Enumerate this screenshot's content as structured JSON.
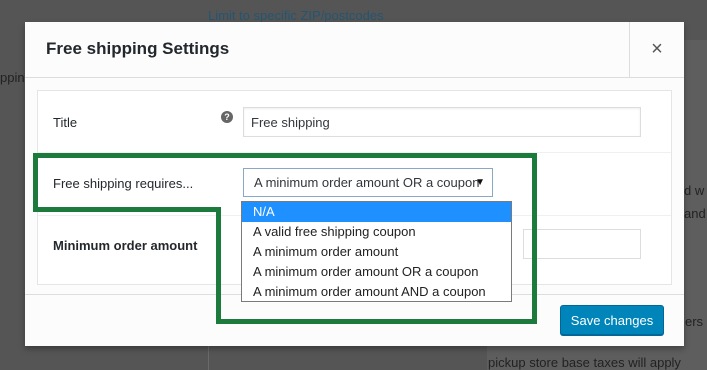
{
  "background": {
    "top_link": "Limit to specific ZIP/postcodes",
    "left_fragment": "pping",
    "right_fragments": [
      "d w",
      "and"
    ],
    "bottom_fragments": [
      "ers",
      "pickup store base taxes will apply"
    ]
  },
  "modal": {
    "title": "Free shipping Settings",
    "close_label": "×",
    "fields": {
      "title": {
        "label": "Title",
        "help_icon": "?",
        "value": "Free shipping"
      },
      "requires": {
        "label": "Free shipping requires...",
        "selected": "A minimum order amount OR a coupon",
        "arrow": "▼",
        "options": [
          "N/A",
          "A valid free shipping coupon",
          "A minimum order amount",
          "A minimum order amount OR a coupon",
          "A minimum order amount AND a coupon"
        ],
        "highlighted_option": 0
      },
      "min_amount": {
        "label": "Minimum order amount",
        "value": ""
      }
    },
    "save_label": "Save changes"
  },
  "colors": {
    "accent": "#0085ba",
    "highlight_outline": "#1b7a3c",
    "dropdown_selected": "#1e90ff"
  }
}
